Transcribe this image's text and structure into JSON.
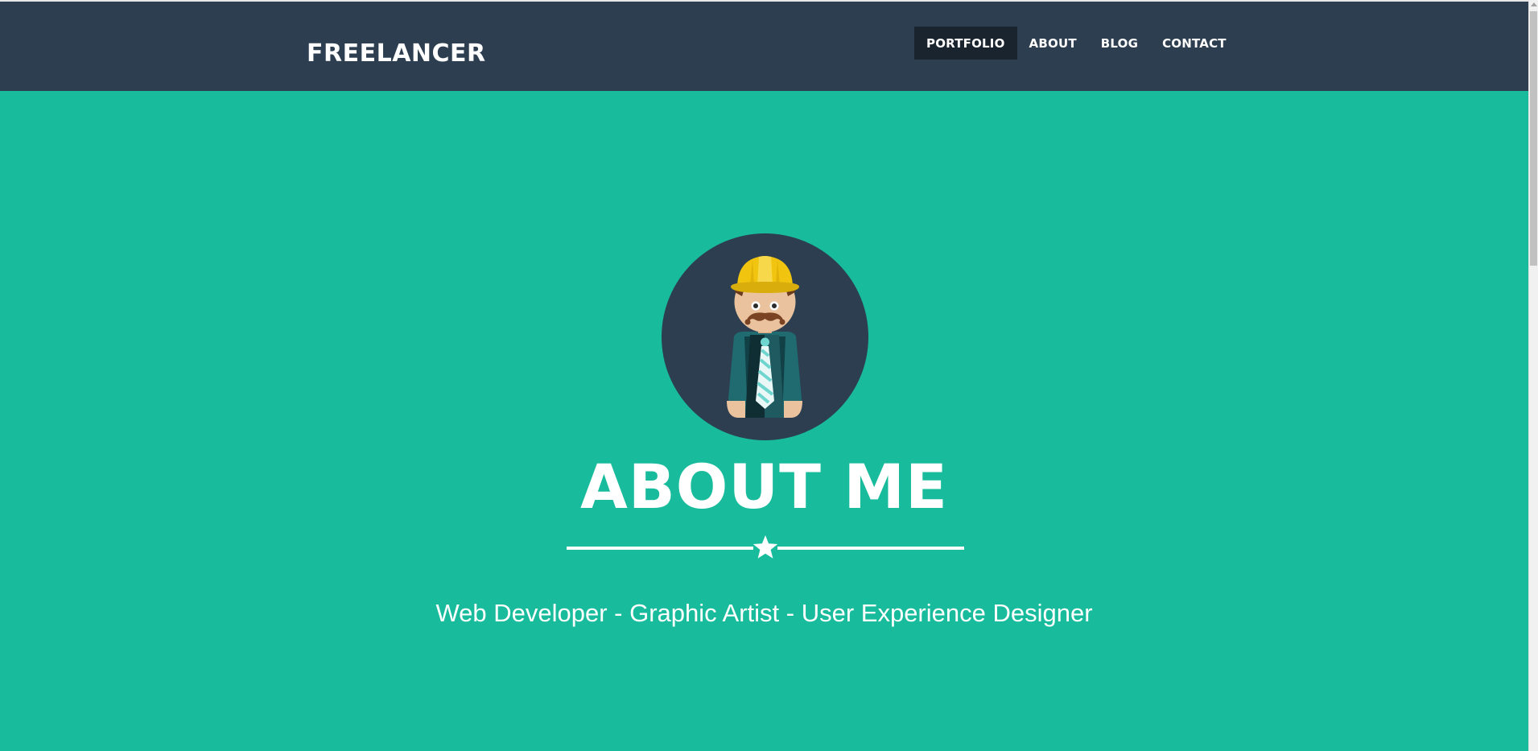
{
  "header": {
    "brand": "FREELANCER",
    "nav": [
      {
        "label": "PORTFOLIO",
        "active": true
      },
      {
        "label": "ABOUT",
        "active": false
      },
      {
        "label": "BLOG",
        "active": false
      },
      {
        "label": "CONTACT",
        "active": false
      }
    ]
  },
  "hero": {
    "avatar_icon": "freelancer-avatar-icon",
    "title": "ABOUT ME",
    "divider_icon": "star-icon",
    "subtitle": "Web Developer - Graphic Artist - User Experience Designer"
  },
  "colors": {
    "navbar_bg": "#2c3e50",
    "nav_active_bg": "#1a242f",
    "hero_bg": "#18bc9c",
    "text": "#ffffff",
    "helmet": "#f1c40f"
  }
}
